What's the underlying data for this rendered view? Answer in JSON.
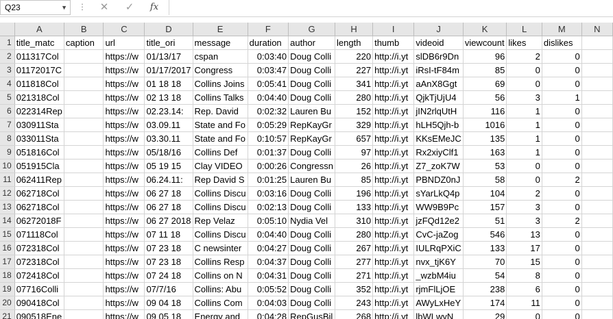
{
  "name_box": "Q23",
  "formula_bar": {
    "fx_label": "fx",
    "cancel_glyph": "✕",
    "enter_glyph": "✓",
    "dots": "⋮",
    "value": ""
  },
  "columns": [
    "A",
    "B",
    "C",
    "D",
    "E",
    "F",
    "G",
    "H",
    "I",
    "J",
    "K",
    "L",
    "M",
    "N"
  ],
  "row_numbers": [
    "1",
    "2",
    "3",
    "4",
    "5",
    "6",
    "7",
    "8",
    "9",
    "10",
    "11",
    "12",
    "13",
    "14",
    "15",
    "16",
    "17",
    "18",
    "19",
    "20",
    "21"
  ],
  "numeric_columns": [
    5,
    7,
    10,
    11,
    12
  ],
  "rows": [
    [
      "title_matc",
      "caption",
      "url",
      "title_ori",
      "message",
      "duration",
      "author",
      "length",
      "thumb",
      "videoid",
      "viewcount",
      "likes",
      "dislikes",
      ""
    ],
    [
      "011317Col",
      "",
      "https://w",
      "01/13/17",
      "cspan",
      "0:03:40",
      "Doug Colli",
      "220",
      "http://i.yt",
      "slDB6r9Dn",
      "96",
      "2",
      "0",
      ""
    ],
    [
      "01172017C",
      "",
      "https://w",
      "01/17/2017",
      "Congress",
      "0:03:47",
      "Doug Colli",
      "227",
      "http://i.yt",
      "iRsI-tF84m",
      "85",
      "0",
      "0",
      ""
    ],
    [
      "011818Col",
      "",
      "https://w",
      "01 18 18",
      "Collins Joins",
      "0:05:41",
      "Doug Colli",
      "341",
      "http://i.yt",
      "aAnX8Ggt",
      "69",
      "0",
      "0",
      ""
    ],
    [
      "021318Col",
      "",
      "https://w",
      "02 13 18",
      "Collins Talks",
      "0:04:40",
      "Doug Colli",
      "280",
      "http://i.yt",
      "QjkTjUjU4",
      "56",
      "3",
      "1",
      ""
    ],
    [
      "022314Rep",
      "",
      "https://w",
      "02.23.14:",
      "Rep. David",
      "0:02:32",
      "Lauren Bu",
      "152",
      "http://i.yt",
      "jIN2rlqUtH",
      "116",
      "1",
      "0",
      ""
    ],
    [
      "030911Sta",
      "",
      "https://w",
      "03.09.11",
      "State and Fo",
      "0:05:29",
      "RepKayGr",
      "329",
      "http://i.yt",
      "hLH5Qjh-b",
      "1016",
      "1",
      "0",
      ""
    ],
    [
      "033011Sta",
      "",
      "https://w",
      "03.30.11",
      "State and Fo",
      "0:10:57",
      "RepKayGr",
      "657",
      "http://i.yt",
      "KKsEMeJC",
      "135",
      "1",
      "0",
      ""
    ],
    [
      "051816Col",
      "",
      "https://w",
      "05/18/16",
      "Collins Def",
      "0:01:37",
      "Doug Colli",
      "97",
      "http://i.yt",
      "Rx2xiyClf1",
      "163",
      "1",
      "0",
      ""
    ],
    [
      "051915Cla",
      "",
      "https://w",
      "05 19 15",
      "Clay VIDEO",
      "0:00:26",
      "Congressn",
      "26",
      "http://i.yt",
      "Z7_zoK7W",
      "53",
      "0",
      "0",
      ""
    ],
    [
      "062411Rep",
      "",
      "https://w",
      "06.24.11:",
      "Rep David S",
      "0:01:25",
      "Lauren Bu",
      "85",
      "http://i.yt",
      "PBNDZ0nJ",
      "58",
      "0",
      "2",
      ""
    ],
    [
      "062718Col",
      "",
      "https://w",
      "06 27 18",
      "Collins Discu",
      "0:03:16",
      "Doug Colli",
      "196",
      "http://i.yt",
      "sYarLkQ4p",
      "104",
      "2",
      "0",
      ""
    ],
    [
      "062718Col",
      "",
      "https://w",
      "06 27 18",
      "Collins Discu",
      "0:02:13",
      "Doug Colli",
      "133",
      "http://i.yt",
      "WW9B9Pc",
      "157",
      "3",
      "0",
      ""
    ],
    [
      "06272018F",
      "",
      "https://w",
      "06 27 2018",
      "Rep  Velaz",
      "0:05:10",
      "Nydia Vel",
      "310",
      "http://i.yt",
      "jzFQd12e2",
      "51",
      "3",
      "2",
      ""
    ],
    [
      "071118Col",
      "",
      "https://w",
      "07 11 18",
      "Collins Discu",
      "0:04:40",
      "Doug Colli",
      "280",
      "http://i.yt",
      "CvC-jaZog",
      "546",
      "13",
      "0",
      ""
    ],
    [
      "072318Col",
      "",
      "https://w",
      "07 23 18",
      "C newsinter",
      "0:04:27",
      "Doug Colli",
      "267",
      "http://i.yt",
      "IULRqPXiC",
      "133",
      "17",
      "0",
      ""
    ],
    [
      "072318Col",
      "",
      "https://w",
      "07 23 18",
      "Collins Resp",
      "0:04:37",
      "Doug Colli",
      "277",
      "http://i.yt",
      "nvx_tjK6Y",
      "70",
      "15",
      "0",
      ""
    ],
    [
      "072418Col",
      "",
      "https://w",
      "07 24 18",
      "Collins on N",
      "0:04:31",
      "Doug Colli",
      "271",
      "http://i.yt",
      "_wzbM4iu",
      "54",
      "8",
      "0",
      ""
    ],
    [
      "07716Colli",
      "",
      "https://w",
      "07/7/16",
      "Collins: Abu",
      "0:05:52",
      "Doug Colli",
      "352",
      "http://i.yt",
      "rjmFlLjOE",
      "238",
      "6",
      "0",
      ""
    ],
    [
      "090418Col",
      "",
      "https://w",
      "09 04 18",
      "Collins Com",
      "0:04:03",
      "Doug Colli",
      "243",
      "http://i.yt",
      "AWyLxHeY",
      "174",
      "11",
      "0",
      ""
    ],
    [
      "090518Ene",
      "",
      "https://w",
      "09 05 18",
      "Energy and",
      "0:04:28",
      "RepGusBil",
      "268",
      "http://i.yt",
      "lbWLwyN",
      "29",
      "0",
      "0",
      ""
    ]
  ]
}
